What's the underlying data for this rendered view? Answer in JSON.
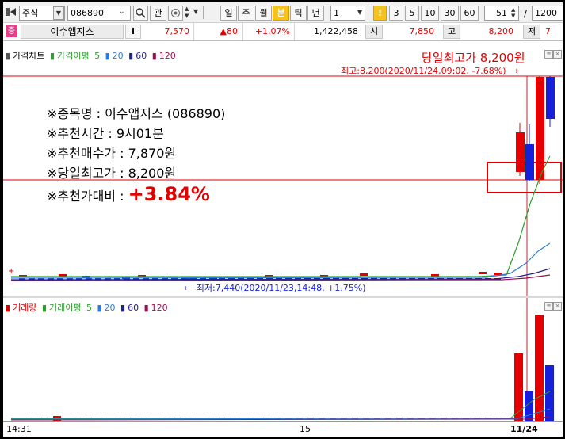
{
  "toolbar": {
    "market_type": "주식",
    "code": "086890",
    "btn_interest": "관",
    "periods": [
      "일",
      "주",
      "월",
      "분",
      "틱",
      "년"
    ],
    "active_period": "분",
    "interval_value": "1",
    "interval_badge": "!",
    "interval_buttons": [
      "3",
      "5",
      "10",
      "30",
      "60"
    ],
    "count": "51",
    "slash": "/",
    "total": "1200"
  },
  "quote": {
    "market_icon": "증",
    "stock_name": "이수앱지스",
    "info_btn": "i",
    "price": "7,570",
    "change": "▲80",
    "change_pct": "+1.07%",
    "volume": "1,422,458",
    "open_label": "시",
    "open_value": "7,850",
    "high_label": "고",
    "high_value": "8,200",
    "low_label": "저"
  },
  "price_chart": {
    "legend": {
      "name": "가격차트",
      "ma_name": "가격이평",
      "ma_values": [
        "5",
        "20",
        "60",
        "120"
      ]
    },
    "high_title": "당일최고가 8,200원",
    "high_note": "최고:8,200(2020/11/24,09:02, -7.68%)⟶",
    "low_note": "⟵최저:7,440(2020/11/23,14:48, +1.75%)"
  },
  "annotation": {
    "line1": "※종목명 : 이수앱지스 (086890)",
    "line2": "※추천시간 : 9시01분",
    "line3": "※추천매수가 : 7,870원",
    "line4": "※당일최고가 : 8,200원",
    "line5_label": "※추천가대비 :",
    "line5_value": "+3.84%"
  },
  "volume_chart": {
    "legend": {
      "name": "거래량",
      "ma_name": "거래이평",
      "ma_values": [
        "5",
        "20",
        "60",
        "120"
      ]
    }
  },
  "x_axis": {
    "labels": [
      "14:31",
      "15",
      "11/24"
    ]
  },
  "colors": {
    "up": "#e40000",
    "down": "#1520d8",
    "ma5": "#2e9e2e",
    "ma20": "#2a7de0",
    "ma60": "#23238f",
    "ma120": "#9a0f52",
    "accent": "#f7c21c"
  }
}
